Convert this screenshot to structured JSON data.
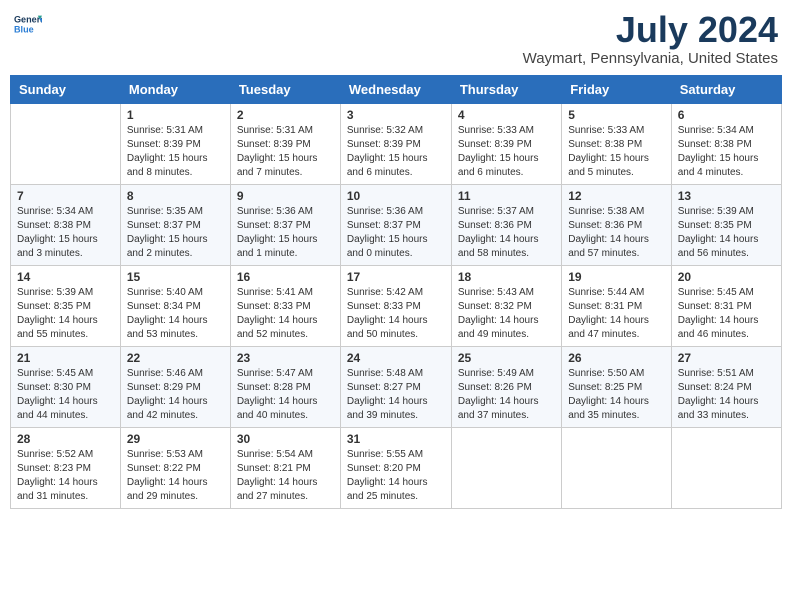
{
  "logo": {
    "line1": "General",
    "line2": "Blue"
  },
  "title": "July 2024",
  "subtitle": "Waymart, Pennsylvania, United States",
  "days_of_week": [
    "Sunday",
    "Monday",
    "Tuesday",
    "Wednesday",
    "Thursday",
    "Friday",
    "Saturday"
  ],
  "weeks": [
    [
      {
        "day": "",
        "info": ""
      },
      {
        "day": "1",
        "info": "Sunrise: 5:31 AM\nSunset: 8:39 PM\nDaylight: 15 hours\nand 8 minutes."
      },
      {
        "day": "2",
        "info": "Sunrise: 5:31 AM\nSunset: 8:39 PM\nDaylight: 15 hours\nand 7 minutes."
      },
      {
        "day": "3",
        "info": "Sunrise: 5:32 AM\nSunset: 8:39 PM\nDaylight: 15 hours\nand 6 minutes."
      },
      {
        "day": "4",
        "info": "Sunrise: 5:33 AM\nSunset: 8:39 PM\nDaylight: 15 hours\nand 6 minutes."
      },
      {
        "day": "5",
        "info": "Sunrise: 5:33 AM\nSunset: 8:38 PM\nDaylight: 15 hours\nand 5 minutes."
      },
      {
        "day": "6",
        "info": "Sunrise: 5:34 AM\nSunset: 8:38 PM\nDaylight: 15 hours\nand 4 minutes."
      }
    ],
    [
      {
        "day": "7",
        "info": "Sunrise: 5:34 AM\nSunset: 8:38 PM\nDaylight: 15 hours\nand 3 minutes."
      },
      {
        "day": "8",
        "info": "Sunrise: 5:35 AM\nSunset: 8:37 PM\nDaylight: 15 hours\nand 2 minutes."
      },
      {
        "day": "9",
        "info": "Sunrise: 5:36 AM\nSunset: 8:37 PM\nDaylight: 15 hours\nand 1 minute."
      },
      {
        "day": "10",
        "info": "Sunrise: 5:36 AM\nSunset: 8:37 PM\nDaylight: 15 hours\nand 0 minutes."
      },
      {
        "day": "11",
        "info": "Sunrise: 5:37 AM\nSunset: 8:36 PM\nDaylight: 14 hours\nand 58 minutes."
      },
      {
        "day": "12",
        "info": "Sunrise: 5:38 AM\nSunset: 8:36 PM\nDaylight: 14 hours\nand 57 minutes."
      },
      {
        "day": "13",
        "info": "Sunrise: 5:39 AM\nSunset: 8:35 PM\nDaylight: 14 hours\nand 56 minutes."
      }
    ],
    [
      {
        "day": "14",
        "info": "Sunrise: 5:39 AM\nSunset: 8:35 PM\nDaylight: 14 hours\nand 55 minutes."
      },
      {
        "day": "15",
        "info": "Sunrise: 5:40 AM\nSunset: 8:34 PM\nDaylight: 14 hours\nand 53 minutes."
      },
      {
        "day": "16",
        "info": "Sunrise: 5:41 AM\nSunset: 8:33 PM\nDaylight: 14 hours\nand 52 minutes."
      },
      {
        "day": "17",
        "info": "Sunrise: 5:42 AM\nSunset: 8:33 PM\nDaylight: 14 hours\nand 50 minutes."
      },
      {
        "day": "18",
        "info": "Sunrise: 5:43 AM\nSunset: 8:32 PM\nDaylight: 14 hours\nand 49 minutes."
      },
      {
        "day": "19",
        "info": "Sunrise: 5:44 AM\nSunset: 8:31 PM\nDaylight: 14 hours\nand 47 minutes."
      },
      {
        "day": "20",
        "info": "Sunrise: 5:45 AM\nSunset: 8:31 PM\nDaylight: 14 hours\nand 46 minutes."
      }
    ],
    [
      {
        "day": "21",
        "info": "Sunrise: 5:45 AM\nSunset: 8:30 PM\nDaylight: 14 hours\nand 44 minutes."
      },
      {
        "day": "22",
        "info": "Sunrise: 5:46 AM\nSunset: 8:29 PM\nDaylight: 14 hours\nand 42 minutes."
      },
      {
        "day": "23",
        "info": "Sunrise: 5:47 AM\nSunset: 8:28 PM\nDaylight: 14 hours\nand 40 minutes."
      },
      {
        "day": "24",
        "info": "Sunrise: 5:48 AM\nSunset: 8:27 PM\nDaylight: 14 hours\nand 39 minutes."
      },
      {
        "day": "25",
        "info": "Sunrise: 5:49 AM\nSunset: 8:26 PM\nDaylight: 14 hours\nand 37 minutes."
      },
      {
        "day": "26",
        "info": "Sunrise: 5:50 AM\nSunset: 8:25 PM\nDaylight: 14 hours\nand 35 minutes."
      },
      {
        "day": "27",
        "info": "Sunrise: 5:51 AM\nSunset: 8:24 PM\nDaylight: 14 hours\nand 33 minutes."
      }
    ],
    [
      {
        "day": "28",
        "info": "Sunrise: 5:52 AM\nSunset: 8:23 PM\nDaylight: 14 hours\nand 31 minutes."
      },
      {
        "day": "29",
        "info": "Sunrise: 5:53 AM\nSunset: 8:22 PM\nDaylight: 14 hours\nand 29 minutes."
      },
      {
        "day": "30",
        "info": "Sunrise: 5:54 AM\nSunset: 8:21 PM\nDaylight: 14 hours\nand 27 minutes."
      },
      {
        "day": "31",
        "info": "Sunrise: 5:55 AM\nSunset: 8:20 PM\nDaylight: 14 hours\nand 25 minutes."
      },
      {
        "day": "",
        "info": ""
      },
      {
        "day": "",
        "info": ""
      },
      {
        "day": "",
        "info": ""
      }
    ]
  ]
}
